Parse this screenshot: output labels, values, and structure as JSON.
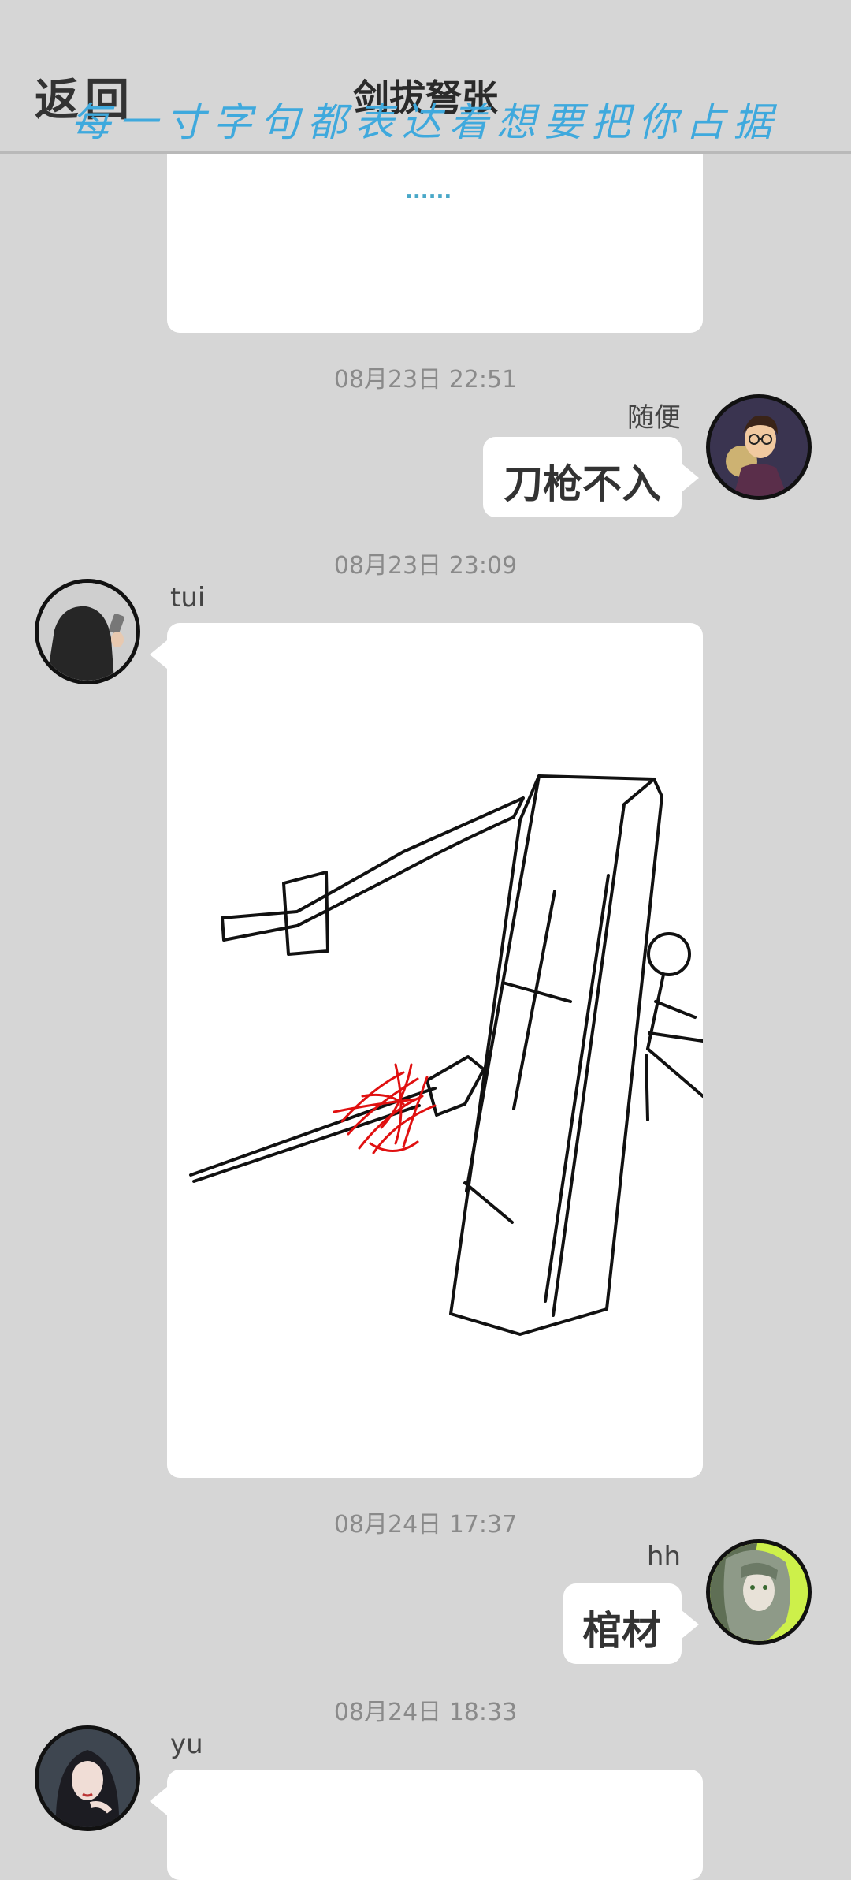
{
  "header": {
    "back_label": "返回",
    "title": "剑拔弩张",
    "subtitle": "每一寸字句都表达着想要把你占据"
  },
  "messages": [
    {
      "type": "drawing-partial",
      "dots": "......"
    },
    {
      "timestamp": "08月23日 22:51",
      "sender": "随便",
      "text": "刀枪不入",
      "side": "right",
      "avatar_icon": "glasses-man-avatar-icon"
    },
    {
      "timestamp": "08月23日 23:09",
      "sender": "tui",
      "type": "drawing",
      "side": "left",
      "avatar_icon": "hooded-figure-avatar-icon",
      "drawing_icon": "sword-spear-shield-sketch-icon"
    },
    {
      "timestamp": "08月24日 17:37",
      "sender": "hh",
      "text": "棺材",
      "side": "right",
      "avatar_icon": "green-haired-character-avatar-icon"
    },
    {
      "timestamp": "08月24日 18:33",
      "sender": "yu",
      "side": "left",
      "avatar_icon": "dark-haired-woman-avatar-icon"
    }
  ],
  "colors": {
    "background": "#d6d6d6",
    "bubble": "#ffffff",
    "subtitle": "#3fa9dd",
    "ink_red": "#e01010"
  }
}
